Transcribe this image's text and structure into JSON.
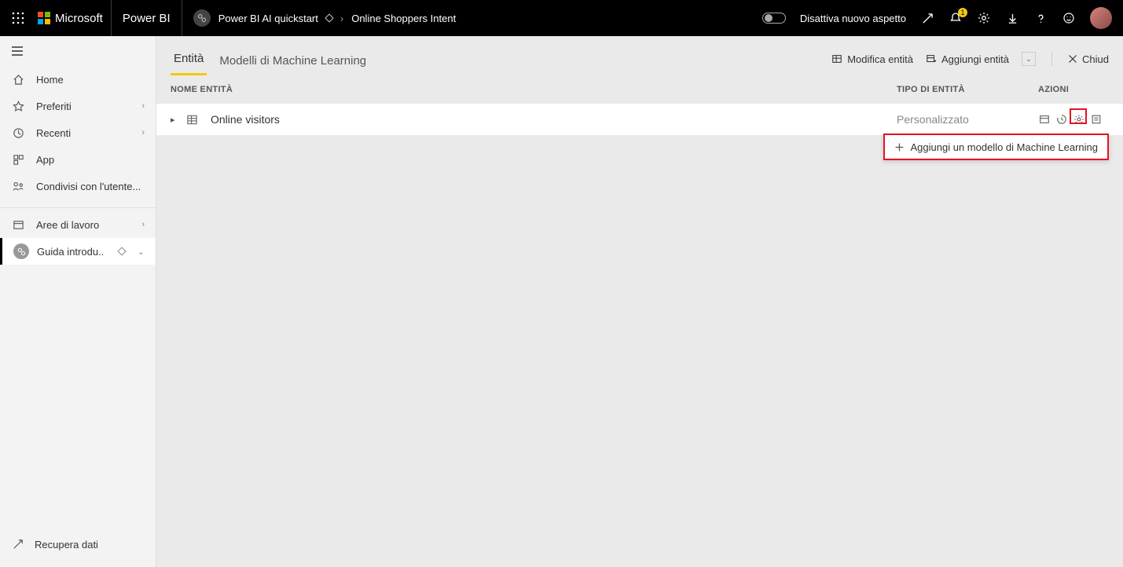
{
  "topbar": {
    "microsoft": "Microsoft",
    "powerbi": "Power BI",
    "breadcrumb_workspace": "Power BI AI quickstart",
    "breadcrumb_item": "Online Shoppers Intent",
    "toggle_label": "Disattiva nuovo aspetto",
    "notif_count": "1"
  },
  "sidebar": {
    "home": "Home",
    "favorites": "Preferiti",
    "recent": "Recenti",
    "app": "App",
    "shared": "Condivisi con l'utente...",
    "workspaces": "Aree di lavoro",
    "current_workspace": "Guida introdu..",
    "get_data": "Recupera dati"
  },
  "main": {
    "tabs": {
      "entities": "Entità",
      "ml_models": "Modelli di Machine Learning"
    },
    "actions": {
      "edit_entities": "Modifica entità",
      "add_entities": "Aggiungi entità",
      "close": "Chiud"
    },
    "columns": {
      "name": "NOME ENTITÀ",
      "type": "TIPO DI ENTITÀ",
      "actions": "AZIONI"
    },
    "rows": [
      {
        "name": "Online visitors",
        "type": "Personalizzato"
      }
    ],
    "popup_label": "Aggiungi un modello di Machine Learning"
  }
}
